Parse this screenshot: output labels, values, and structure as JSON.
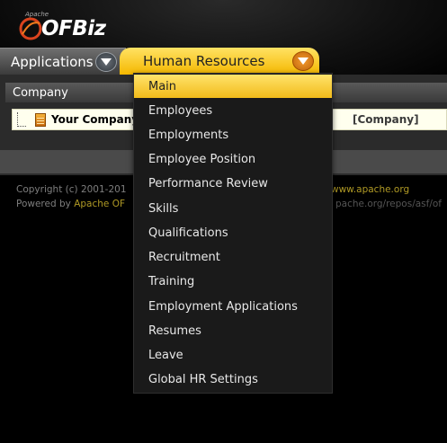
{
  "logo": {
    "text": "OFBiz",
    "small_text": "Apache"
  },
  "tabs": {
    "applications_label": "Applications",
    "human_resources_label": "Human Resources"
  },
  "panel": {
    "header": "Company",
    "tree_item": "Your Company",
    "tree_item_suffix": "[Company]"
  },
  "footer": {
    "copyright_prefix": "Copyright (c) 2001-201",
    "copyright_link": "www.apache.org",
    "powered_prefix": "Powered by ",
    "powered_link": "Apache OF",
    "powered_right": "pache.org/repos/asf/of"
  },
  "menu": {
    "items": [
      {
        "label": "Main",
        "active": true
      },
      {
        "label": "Employees"
      },
      {
        "label": "Employments"
      },
      {
        "label": "Employee Position"
      },
      {
        "label": "Performance Review"
      },
      {
        "label": "Skills"
      },
      {
        "label": "Qualifications"
      },
      {
        "label": "Recruitment"
      },
      {
        "label": "Training"
      },
      {
        "label": "Employment Applications"
      },
      {
        "label": "Resumes"
      },
      {
        "label": "Leave"
      },
      {
        "label": "Global HR Settings"
      }
    ]
  },
  "colors": {
    "accent": "#f5b800",
    "link": "#b09a25",
    "background": "#000000"
  }
}
